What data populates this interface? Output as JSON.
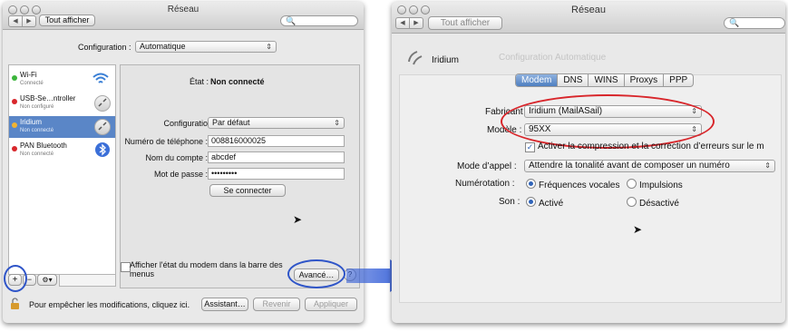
{
  "left_window": {
    "title": "Réseau",
    "show_all": "Tout afficher",
    "search_placeholder": "",
    "config_label": "Configuration :",
    "config_value": "Automatique",
    "services": [
      {
        "name": "Wi-Fi",
        "status": "Connecté",
        "color": "#3bb53b"
      },
      {
        "name": "USB-Se…ntroller",
        "status": "Non configuré",
        "color": "#d8262b"
      },
      {
        "name": "Iridium",
        "status": "Non connecté",
        "color": "#f2b330"
      },
      {
        "name": "PAN Bluetooth",
        "status": "Non connecté",
        "color": "#d8262b"
      }
    ],
    "state_label": "État :",
    "state_value": "Non connecté",
    "form": {
      "configuration_label": "Configuration :",
      "configuration_value": "Par défaut",
      "phone_label": "Numéro de téléphone :",
      "phone_value": "008816000025",
      "account_label": "Nom du compte :",
      "account_value": "abcdef",
      "password_label": "Mot de passe :",
      "password_value": "•••••••••",
      "connect_button": "Se connecter"
    },
    "modem_checkbox_label": "Afficher l'état du modem dans la barre des menus",
    "advanced_button": "Avancé…",
    "help": "?",
    "add": "+",
    "lock_text": "Pour empêcher les modifications, cliquez ici.",
    "assistant_button": "Assistant…",
    "revert_button": "Revenir",
    "apply_button": "Appliquer"
  },
  "right_window": {
    "title": "Réseau",
    "show_all": "Tout afficher",
    "service_name": "Iridium",
    "bg_config_label": "Configuration",
    "bg_config_value": "Automatique",
    "tabs": [
      "Modem",
      "DNS",
      "WINS",
      "Proxys",
      "PPP"
    ],
    "active_tab": "Modem",
    "vendor_label": "Fabricant :",
    "vendor_value": "Iridium (MailASail)",
    "model_label": "Modèle :",
    "model_value": "95XX",
    "compression_label": "Activer la compression et la correction d’erreurs sur le m",
    "dial_mode_label": "Mode d’appel :",
    "dial_mode_value": "Attendre la tonalité avant de composer un numéro",
    "dialing_label": "Numérotation :",
    "dialing_options": [
      "Fréquences vocales",
      "Impulsions"
    ],
    "sound_label": "Son :",
    "sound_options": [
      "Activé",
      "Désactivé"
    ]
  },
  "colors": {
    "annotation_red": "#d8262b",
    "annotation_blue": "#2f55c8",
    "arrow_blue": "#2f5ad6",
    "selection_blue": "#5a86c7"
  }
}
